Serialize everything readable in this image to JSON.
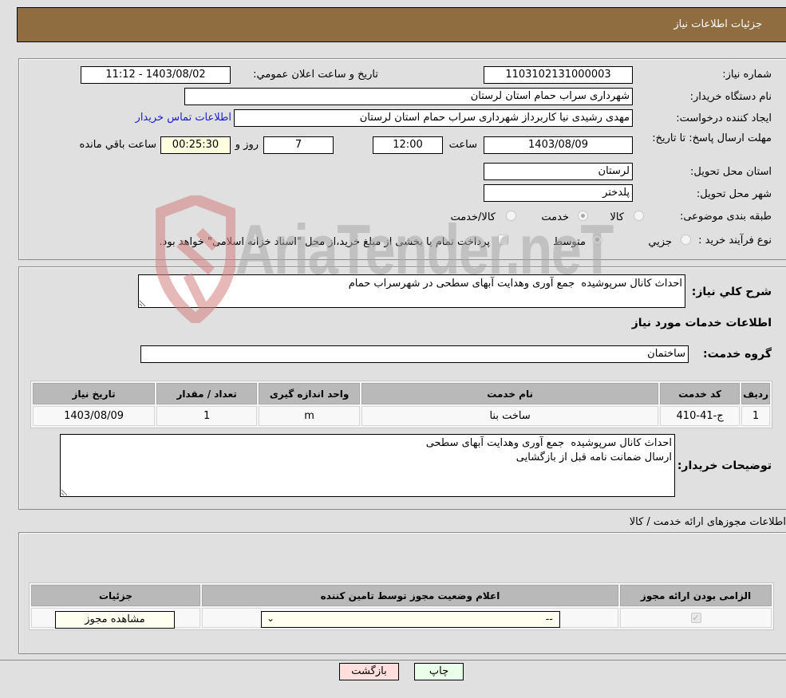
{
  "header": {
    "title": "جزئیات اطلاعات نیاز"
  },
  "form": {
    "need_number_label": "شماره نیاز:",
    "need_number": "1103102131000003",
    "announce_label": "تاریخ و ساعت اعلان عمومي:",
    "announce_value": "1403/08/02 - 11:12",
    "buyer_org_label": "نام دستگاه خریدار:",
    "buyer_org": "شهرداری سراب حمام استان لرستان",
    "creator_label": "ایجاد کننده درخواست:",
    "creator": "مهدی رشیدی نیا کاربرداز شهرداری سراب حمام استان لرستان",
    "contact_link": "اطلاعات تماس خریدار",
    "deadline_label": "مهلت ارسال پاسخ: تا تاریخ:",
    "deadline_date": "1403/08/09",
    "time_label": "ساعت",
    "deadline_time": "12:00",
    "days_value": "7",
    "days_label": "روز و",
    "remaining_time": "00:25:30",
    "remaining_label": "ساعت باقي مانده",
    "province_label": "استان محل تحویل:",
    "province": "لرستان",
    "city_label": "شهر محل تحویل:",
    "city": "پلدختر",
    "category_label": "طبقه بندی موضوعی:",
    "category_options": [
      {
        "label": "کالا",
        "selected": false
      },
      {
        "label": "خدمت",
        "selected": true
      },
      {
        "label": "کالا/خدمت",
        "selected": false
      }
    ],
    "process_label": "نوع فرآیند خرید :",
    "process_options": [
      {
        "label": "جزيي",
        "selected": false
      },
      {
        "label": "متوسط",
        "selected": true
      }
    ],
    "treasury_note": "پرداخت تمام یا بخشی از مبلغ خرید،از محل \"اسناد خزانه اسلامی\" خواهد بود.",
    "treasury_checked": false
  },
  "services": {
    "general_desc_label": "شرح کلي نیاز:",
    "general_desc": "احداث کانال سرپوشیده  جمع آوری وهدایت آبهای سطحی در شهرسراب حمام",
    "section_title": "اطلاعات خدمات مورد نیاز",
    "service_group_label": "گروه خدمت:",
    "service_group": "ساختمان",
    "table": {
      "headers": [
        "ردیف",
        "کد خدمت",
        "نام خدمت",
        "واحد اندازه گیری",
        "تعداد / مقدار",
        "تاریخ نیاز"
      ],
      "rows": [
        [
          "1",
          "ج-41-410",
          "ساخت بنا",
          "m",
          "1",
          "1403/08/09"
        ]
      ]
    },
    "buyer_notes_label": "توضیحات خریدار:",
    "buyer_notes": "احداث کانال سرپوشیده  جمع آوری وهدایت آبهای سطحی\nارسال ضمانت نامه قبل از بازگشایی"
  },
  "permits": {
    "title": "اطلاعات مجوزهای ارائه خدمت / کالا",
    "headers": [
      "الزامی بودن ارائه مجوز",
      "اعلام وضعیت مجوز توسط تامین کننده",
      "جزئیات"
    ],
    "row": {
      "required_checked": true,
      "status_value": "--",
      "details_button": "مشاهده مجوز"
    }
  },
  "footer": {
    "print_button": "چاپ",
    "back_button": "بازگشت"
  },
  "watermark": {
    "text": "AriaTender.neT"
  },
  "colors": {
    "header_bg": "#8f6d41",
    "link": "#1a1acd",
    "print_bg": "#eaffea",
    "back_bg": "#ffdede"
  }
}
